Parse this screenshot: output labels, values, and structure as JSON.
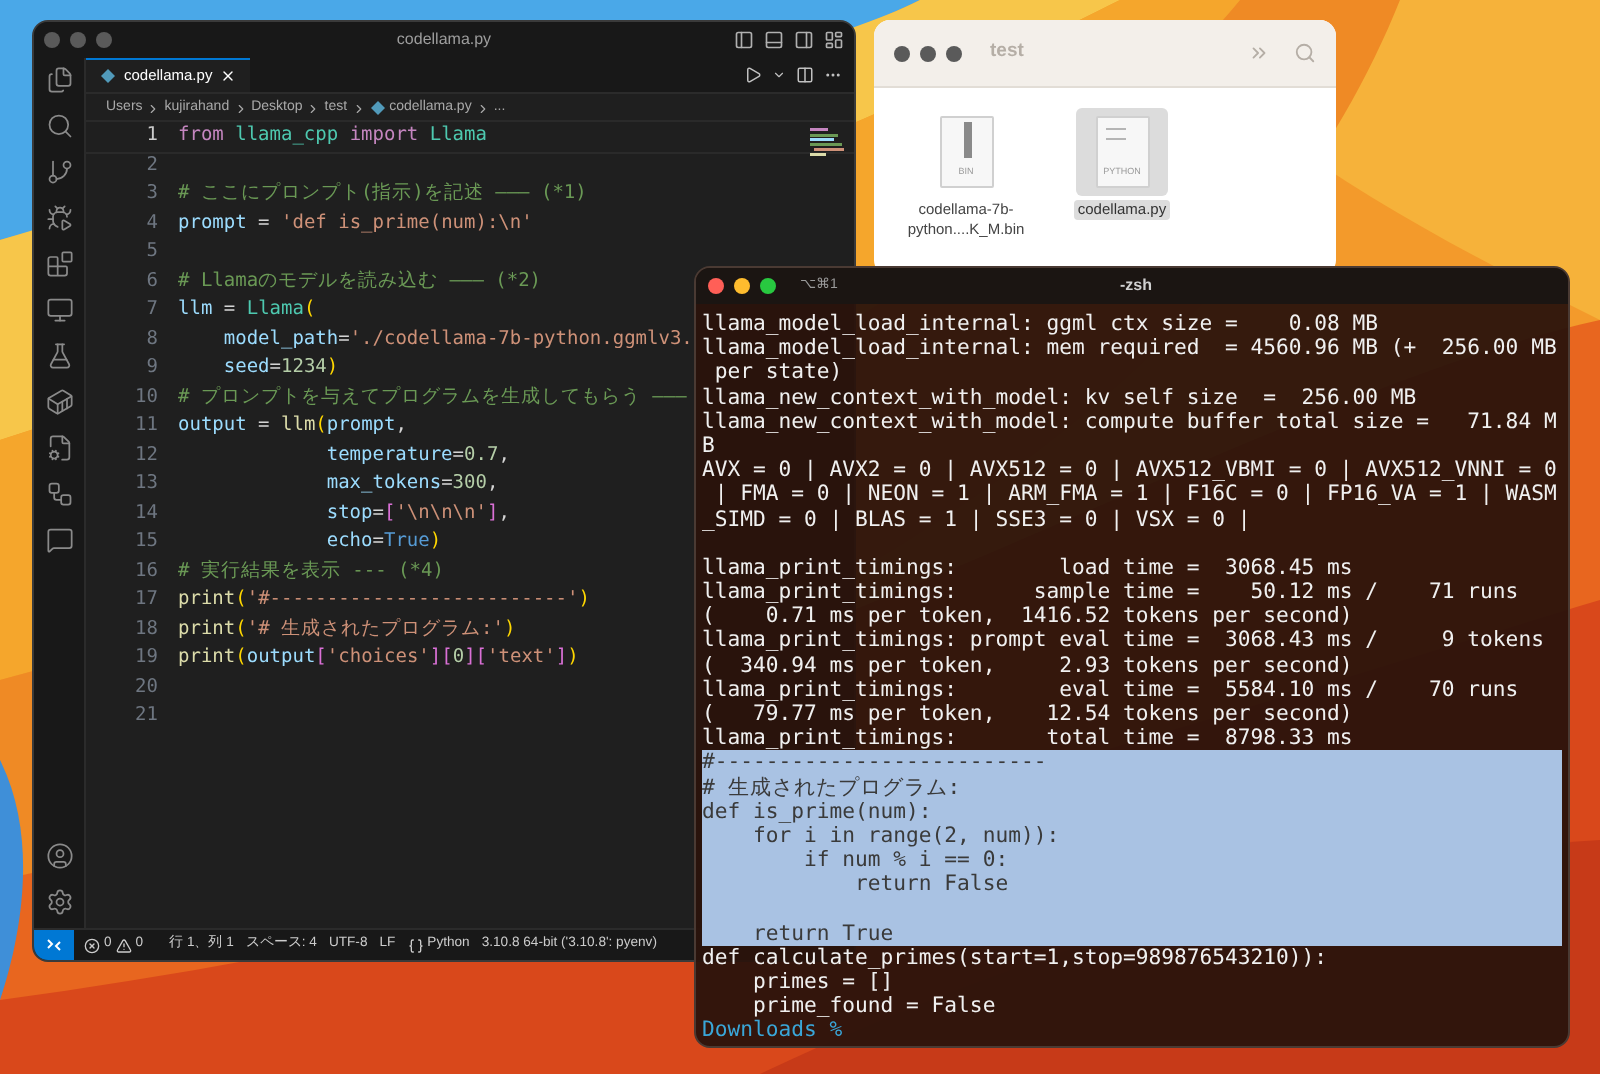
{
  "vscode": {
    "title": "codellama.py",
    "tab": {
      "label": "codellama.py",
      "selected": true
    },
    "breadcrumbs": [
      {
        "text": "Users",
        "kind": "folder"
      },
      {
        "text": "kujirahand",
        "kind": "folder"
      },
      {
        "text": "Desktop",
        "kind": "folder"
      },
      {
        "text": "test",
        "kind": "folder"
      },
      {
        "text": "codellama.py",
        "kind": "file"
      },
      {
        "text": "...",
        "kind": "more"
      }
    ],
    "lines": [
      {
        "number": "1",
        "current": true,
        "tokens": [
          {
            "kind": "kw",
            "text": "from "
          },
          {
            "kind": "cls",
            "text": "llama_cpp "
          },
          {
            "kind": "kw",
            "text": "import "
          },
          {
            "kind": "cls",
            "text": "Llama"
          }
        ]
      },
      {
        "number": "2",
        "current": false
      },
      {
        "number": "3",
        "current": false,
        "tokens": [
          {
            "kind": "cmt",
            "text": "# ここにプロンプト(指示)を記述 ――― (*1)"
          }
        ]
      },
      {
        "number": "4",
        "current": false,
        "tokens": [
          {
            "kind": "var",
            "text": "prompt"
          },
          {
            "kind": "plain",
            "text": " = "
          },
          {
            "kind": "str",
            "text": "'def is_prime(num):\\n'"
          }
        ]
      },
      {
        "number": "5",
        "current": false
      },
      {
        "number": "6",
        "current": false,
        "tokens": [
          {
            "kind": "cmt",
            "text": "# Llamaのモデルを読み込む ――― (*2)"
          }
        ]
      },
      {
        "number": "7",
        "current": false,
        "tokens": [
          {
            "kind": "var",
            "text": "llm"
          },
          {
            "kind": "plain",
            "text": " = "
          },
          {
            "kind": "cls",
            "text": "Llama"
          },
          {
            "kind": "paren",
            "text": "("
          }
        ]
      },
      {
        "number": "8",
        "current": false,
        "tokens": [
          {
            "kind": "var",
            "text": "    model_path"
          },
          {
            "kind": "plain",
            "text": "="
          },
          {
            "kind": "str",
            "text": "'./codellama-7b-python.ggmlv3."
          }
        ]
      },
      {
        "number": "9",
        "current": false,
        "tokens": [
          {
            "kind": "var",
            "text": "    seed"
          },
          {
            "kind": "plain",
            "text": "="
          },
          {
            "kind": "num",
            "text": "1234"
          },
          {
            "kind": "paren",
            "text": ")"
          }
        ]
      },
      {
        "number": "10",
        "current": false,
        "tokens": [
          {
            "kind": "cmt",
            "text": "# プロンプトを与えてプログラムを生成してもらう ―――"
          }
        ]
      },
      {
        "number": "11",
        "current": false,
        "tokens": [
          {
            "kind": "var",
            "text": "output"
          },
          {
            "kind": "plain",
            "text": " = "
          },
          {
            "kind": "fn",
            "text": "llm"
          },
          {
            "kind": "paren",
            "text": "("
          },
          {
            "kind": "var",
            "text": "prompt"
          },
          {
            "kind": "plain",
            "text": ","
          }
        ]
      },
      {
        "number": "12",
        "current": false,
        "tokens": [
          {
            "kind": "var",
            "text": "             temperature"
          },
          {
            "kind": "plain",
            "text": "="
          },
          {
            "kind": "num",
            "text": "0.7"
          },
          {
            "kind": "plain",
            "text": ","
          }
        ]
      },
      {
        "number": "13",
        "current": false,
        "tokens": [
          {
            "kind": "var",
            "text": "             max_tokens"
          },
          {
            "kind": "plain",
            "text": "="
          },
          {
            "kind": "num",
            "text": "300"
          },
          {
            "kind": "plain",
            "text": ","
          }
        ]
      },
      {
        "number": "14",
        "current": false,
        "tokens": [
          {
            "kind": "var",
            "text": "             stop"
          },
          {
            "kind": "plain",
            "text": "="
          },
          {
            "kind": "bracket",
            "text": "["
          },
          {
            "kind": "str",
            "text": "'\\n\\n\\n'"
          },
          {
            "kind": "bracket",
            "text": "]"
          },
          {
            "kind": "plain",
            "text": ","
          }
        ]
      },
      {
        "number": "15",
        "current": false,
        "tokens": [
          {
            "kind": "var",
            "text": "             echo"
          },
          {
            "kind": "plain",
            "text": "="
          },
          {
            "kind": "const",
            "text": "True"
          },
          {
            "kind": "paren",
            "text": ")"
          }
        ]
      },
      {
        "number": "16",
        "current": false,
        "tokens": [
          {
            "kind": "cmt",
            "text": "# 実行結果を表示 --- (*4)"
          }
        ]
      },
      {
        "number": "17",
        "current": false,
        "tokens": [
          {
            "kind": "fn",
            "text": "print"
          },
          {
            "kind": "paren",
            "text": "("
          },
          {
            "kind": "str",
            "text": "'#--------------------------'"
          },
          {
            "kind": "paren",
            "text": ")"
          }
        ]
      },
      {
        "number": "18",
        "current": false,
        "tokens": [
          {
            "kind": "fn",
            "text": "print"
          },
          {
            "kind": "paren",
            "text": "("
          },
          {
            "kind": "str",
            "text": "'# 生成されたプログラム:'"
          },
          {
            "kind": "paren",
            "text": ")"
          }
        ]
      },
      {
        "number": "19",
        "current": false,
        "tokens": [
          {
            "kind": "fn",
            "text": "print"
          },
          {
            "kind": "paren",
            "text": "("
          },
          {
            "kind": "var",
            "text": "output"
          },
          {
            "kind": "bracket",
            "text": "["
          },
          {
            "kind": "str",
            "text": "'choices'"
          },
          {
            "kind": "bracket",
            "text": "]["
          },
          {
            "kind": "num",
            "text": "0"
          },
          {
            "kind": "bracket",
            "text": "]["
          },
          {
            "kind": "str",
            "text": "'text'"
          },
          {
            "kind": "bracket",
            "text": "]"
          },
          {
            "kind": "paren",
            "text": ")"
          }
        ]
      },
      {
        "number": "20",
        "current": false
      },
      {
        "number": "21",
        "current": false
      }
    ],
    "status_bar": {
      "problems": [
        {
          "kind": "error",
          "count": "0"
        },
        {
          "kind": "warning",
          "count": "0"
        }
      ],
      "items": [
        {
          "kind": "text",
          "text": "行 1、列 1"
        },
        {
          "kind": "text",
          "text": "スペース: 4"
        },
        {
          "kind": "text",
          "text": "UTF-8"
        },
        {
          "kind": "text",
          "text": "LF"
        },
        {
          "kind": "language",
          "text": "Python"
        },
        {
          "kind": "text",
          "text": "3.10.8 64-bit ('3.10.8': pyenv)"
        }
      ]
    }
  },
  "finder": {
    "title": "test",
    "files": [
      {
        "name_lines": [
          "codellama-7b-",
          "python....K_M.bin"
        ],
        "badge": "BIN",
        "kind": "bin",
        "selected": false
      },
      {
        "name_lines": [
          "codellama.py"
        ],
        "badge": "PYTHON",
        "kind": "python",
        "selected": true
      }
    ]
  },
  "terminal": {
    "shortcut": "⌥⌘1",
    "title": "-zsh",
    "rows": [
      {
        "kind": "text",
        "selected": false,
        "text": "llama_model_load_internal: ggml ctx size =    0.08 MB"
      },
      {
        "kind": "text",
        "selected": false,
        "text": "llama_model_load_internal: mem required  = 4560.96 MB (+  256.00 MB"
      },
      {
        "kind": "text",
        "selected": false,
        "text": " per state)"
      },
      {
        "kind": "text",
        "selected": false,
        "text": "llama_new_context_with_model: kv self size  =  256.00 MB"
      },
      {
        "kind": "text",
        "selected": false,
        "text": "llama_new_context_with_model: compute buffer total size =   71.84 M"
      },
      {
        "kind": "text",
        "selected": false,
        "text": "B"
      },
      {
        "kind": "text",
        "selected": false,
        "text": "AVX = 0 | AVX2 = 0 | AVX512 = 0 | AVX512_VBMI = 0 | AVX512_VNNI = 0"
      },
      {
        "kind": "text",
        "selected": false,
        "text": " | FMA = 0 | NEON = 1 | ARM_FMA = 1 | F16C = 0 | FP16_VA = 1 | WASM"
      },
      {
        "kind": "text",
        "selected": false,
        "text": "_SIMD = 0 | BLAS = 1 | SSE3 = 0 | VSX = 0 |"
      },
      {
        "kind": "blank",
        "selected": false
      },
      {
        "kind": "text",
        "selected": false,
        "text": "llama_print_timings:        load time =  3068.45 ms"
      },
      {
        "kind": "text",
        "selected": false,
        "text": "llama_print_timings:      sample time =    50.12 ms /    71 runs"
      },
      {
        "kind": "text",
        "selected": false,
        "text": "(    0.71 ms per token,  1416.52 tokens per second)"
      },
      {
        "kind": "text",
        "selected": false,
        "text": "llama_print_timings: prompt eval time =  3068.43 ms /     9 tokens"
      },
      {
        "kind": "text",
        "selected": false,
        "text": "(  340.94 ms per token,     2.93 tokens per second)"
      },
      {
        "kind": "text",
        "selected": false,
        "text": "llama_print_timings:        eval time =  5584.10 ms /    70 runs"
      },
      {
        "kind": "text",
        "selected": false,
        "text": "(   79.77 ms per token,    12.54 tokens per second)"
      },
      {
        "kind": "text",
        "selected": false,
        "text": "llama_print_timings:       total time =  8798.33 ms"
      },
      {
        "kind": "text",
        "selected": true,
        "text": "#--------------------------"
      },
      {
        "kind": "text",
        "selected": true,
        "text": "# 生成されたプログラム:"
      },
      {
        "kind": "text",
        "selected": true,
        "text": "def is_prime(num):"
      },
      {
        "kind": "text",
        "selected": true,
        "text": "    for i in range(2, num)):"
      },
      {
        "kind": "text",
        "selected": true,
        "text": "        if num % i == 0:"
      },
      {
        "kind": "text",
        "selected": true,
        "text": "            return False"
      },
      {
        "kind": "blank",
        "selected": true
      },
      {
        "kind": "text",
        "selected": true,
        "text": "    return True"
      },
      {
        "kind": "text",
        "selected": false,
        "text": "def calculate_primes(start=1,stop=989876543210)):"
      },
      {
        "kind": "text",
        "selected": false,
        "text": "    primes = []"
      },
      {
        "kind": "text",
        "selected": false,
        "text": "    prime_found = False"
      }
    ],
    "prompt": "Downloads %"
  }
}
